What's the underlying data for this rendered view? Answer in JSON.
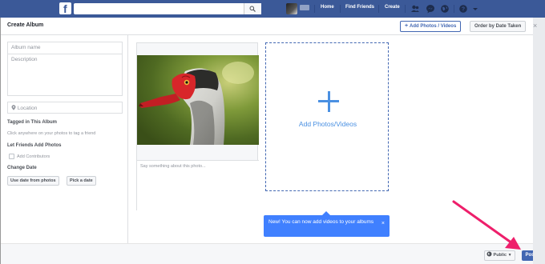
{
  "topbar": {
    "logo": "f",
    "nav": {
      "home": "Home",
      "find_friends": "Find Friends",
      "create": "Create"
    }
  },
  "modal": {
    "title": "Create Album",
    "add_photos_button": "Add Photos / Videos",
    "order_button": "Order by Date Taken",
    "close": "×"
  },
  "left": {
    "album_name_placeholder": "Album name",
    "description_placeholder": "Description",
    "location_placeholder": "Location",
    "tagged_heading": "Tagged in This Album",
    "tagged_hint": "Click anywhere on your photos to tag a friend",
    "friends_heading": "Let Friends Add Photos",
    "add_contributors": "Add Contributors",
    "change_date_heading": "Change Date",
    "use_date_button": "Use date from photos",
    "pick_date_button": "Pick a date"
  },
  "main": {
    "caption_placeholder": "Say something about this photo...",
    "add_card_label": "Add Photos/Videos",
    "tooltip_text": "New! You can now add videos to your albums",
    "tooltip_close": "×"
  },
  "footer": {
    "privacy_label": "Public",
    "post_button": "Post"
  },
  "colors": {
    "facebook_blue": "#3b5998",
    "accent_blue": "#4267b2",
    "tooltip_blue": "#4080ff",
    "annotation_arrow": "#ee1f6b"
  }
}
